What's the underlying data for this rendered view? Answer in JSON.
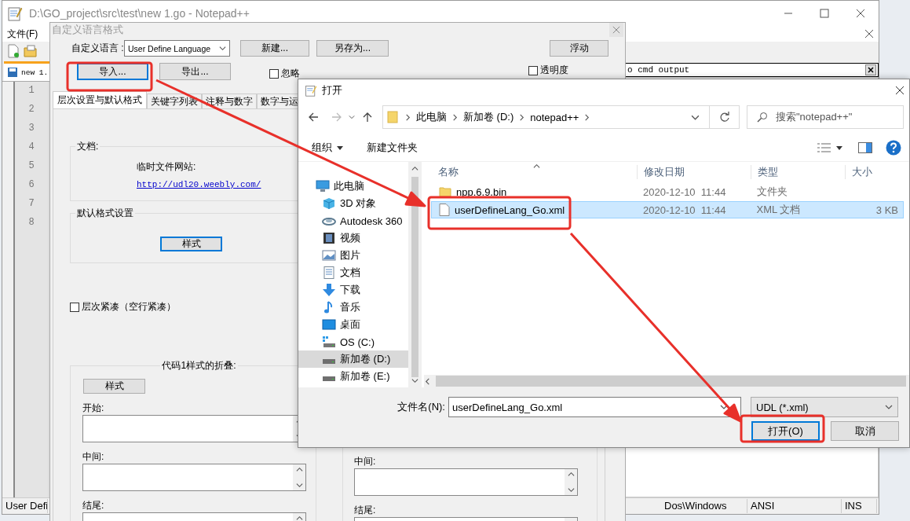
{
  "notepad": {
    "title": "D:\\GO_project\\src\\test\\new 1.go - Notepad++",
    "menu": [
      "文件(F)"
    ],
    "tab": "new 1.",
    "line_numbers": [
      "1",
      "2",
      "3",
      "4",
      "5",
      "6",
      "7",
      "8"
    ],
    "panel": {
      "title": "o cmd output"
    },
    "status_bar": [
      "User Defi",
      "Dos\\Windows",
      "ANSI",
      "INS"
    ]
  },
  "udl_dialog": {
    "title": "自定义语言格式",
    "language_label": "自定义语言 :",
    "language_value": "User Define Language",
    "buttons": [
      "新建...",
      "另存为..."
    ],
    "dock_button": "浮动",
    "import_button": "导入...",
    "export_button": "导出...",
    "ignore_case": {
      "label": "忽略",
      "checked": false
    },
    "transparency": {
      "label": "透明度",
      "checked": false
    },
    "tabs": [
      {
        "label": "层次设置与默认格式",
        "selected": true
      },
      {
        "label": "关键字列表",
        "selected": false
      },
      {
        "label": "注释与数字",
        "selected": false
      },
      {
        "label": "数字与运",
        "selected": false
      }
    ],
    "doc_group": {
      "title": "文档:",
      "label": "临时文件网站:",
      "link": "http://udl20.weebly.com/"
    },
    "default_group": {
      "title": "默认格式设置",
      "button": "样式"
    },
    "compact": {
      "label": "层次紧凑（空行紧凑）",
      "checked": false
    },
    "fold_group": {
      "title": "代码1样式的折叠:",
      "button": "样式",
      "fields": [
        "开始:",
        "中间:",
        "结尾:"
      ]
    },
    "fold_group_2": {
      "fields": [
        "中间:",
        "结尾:"
      ]
    }
  },
  "open_dialog": {
    "title": "打开",
    "breadcrumbs": [
      "此电脑",
      "新加卷 (D:)",
      "notepad++"
    ],
    "search": {
      "placeholder": "搜索\"notepad++\""
    },
    "toolbar": [
      "组织",
      "新建文件夹"
    ],
    "tree": [
      {
        "label": "此电脑",
        "kind": "pc",
        "selected": false,
        "children": [
          {
            "label": "3D 对象",
            "kind": "objects",
            "selected": false
          },
          {
            "label": "Autodesk 360",
            "kind": "cloud",
            "selected": false
          },
          {
            "label": "视频",
            "kind": "video",
            "selected": false
          },
          {
            "label": "图片",
            "kind": "picture",
            "selected": false
          },
          {
            "label": "文档",
            "kind": "doc",
            "selected": false
          },
          {
            "label": "下载",
            "kind": "download",
            "selected": false
          },
          {
            "label": "音乐",
            "kind": "music",
            "selected": false
          },
          {
            "label": "桌面",
            "kind": "desktop",
            "selected": false
          },
          {
            "label": "OS (C:)",
            "kind": "os",
            "selected": false
          },
          {
            "label": "新加卷 (D:)",
            "kind": "drive",
            "selected": true
          },
          {
            "label": "新加卷 (E:)",
            "kind": "drive",
            "selected": false
          }
        ]
      }
    ],
    "columns": [
      "名称",
      "修改日期",
      "类型",
      "大小"
    ],
    "files": [
      {
        "kind": "folder",
        "name": "npp.6.9.bin",
        "date": "2020-12-10  11:44",
        "type": "文件夹",
        "selected": false
      },
      {
        "kind": "file",
        "name": "userDefineLang_Go.xml",
        "date": "2020-12-10  11:44",
        "type": "XML 文档",
        "size": "3 KB",
        "selected": true
      }
    ],
    "filename_label": "文件名(N):",
    "filename": "userDefineLang_Go.xml",
    "filetype": "UDL (*.xml)",
    "open_button": "打开(O)",
    "cancel_button": "取消"
  }
}
